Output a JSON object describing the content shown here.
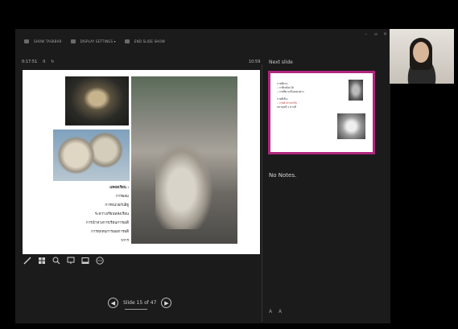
{
  "toolbar": {
    "taskbar_label": "SHOW TASKBAR",
    "display_label": "DISPLAY SETTINGS ▾",
    "end_label": "END SLIDE SHOW"
  },
  "window_controls": {
    "minimize": "–",
    "restore": "▫",
    "close": "×"
  },
  "timer": {
    "elapsed": "0:17:51",
    "pause_icon": "II",
    "reset_icon": "↻"
  },
  "clock": "10:59",
  "current_slide": {
    "text_lines": [
      "แหล่งเรียน :",
      "การผลม",
      "การหน่วยกับอิฐู",
      "ระหว่างเรียนหลังเรียน",
      "การนำหวงการเรียนการเผดิ",
      "การทุกทบการเผยการผดิ",
      "วการ"
    ]
  },
  "tools": [
    {
      "name": "pen-icon",
      "glyph": "╱"
    },
    {
      "name": "see-all-slides-icon",
      "glyph": "▦"
    },
    {
      "name": "zoom-icon",
      "glyph": "🔍"
    },
    {
      "name": "pointer-icon",
      "glyph": "⊡"
    },
    {
      "name": "screen-icon",
      "glyph": "▭"
    },
    {
      "name": "more-options-icon",
      "glyph": "⋯"
    }
  ],
  "navigation": {
    "prev": "◀",
    "next": "▶",
    "slide_counter": "Slide 15 of 47"
  },
  "next_slide": {
    "label": "Next slide",
    "lines": [
      "ภาพที่ผ่าน:",
      "• ภาพี่เหมือนได้",
      "• ภาพที่ผ่านเป็นผมแต่ต่าง",
      "ภาพที่เห็น:",
      "• ภาพผ้าท่ามท่าอื่น",
      "  มหาคุณที่ 1 ตามที่"
    ]
  },
  "notes": {
    "text": "No Notes."
  },
  "font_controls": {
    "decrease": "A",
    "increase": "A"
  }
}
